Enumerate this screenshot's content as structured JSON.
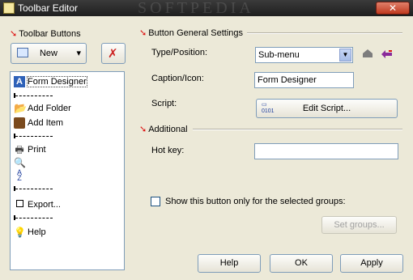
{
  "window": {
    "title": "Toolbar Editor",
    "watermark": "SOFTPEDIA",
    "close_glyph": "✕"
  },
  "left": {
    "section_title": "Toolbar Buttons",
    "new_button": "New",
    "new_dropdown_glyph": "▾",
    "items": [
      {
        "label": "Form Designer",
        "icon": "form-designer-icon",
        "selected": true
      },
      {
        "label": "",
        "divider": true
      },
      {
        "label": "Add Folder",
        "icon": "add-folder-icon"
      },
      {
        "label": "Add Item",
        "icon": "add-item-icon"
      },
      {
        "label": "",
        "divider": true
      },
      {
        "label": "Print",
        "icon": "printer-icon"
      },
      {
        "label": "",
        "icon": "magnifier-icon"
      },
      {
        "label": "",
        "icon": "sort-az-icon"
      },
      {
        "label": "",
        "divider": true
      },
      {
        "label": "Export...",
        "icon": "checkbox-icon"
      },
      {
        "label": "",
        "divider": true
      },
      {
        "label": "Help",
        "icon": "lightbulb-icon"
      }
    ]
  },
  "general": {
    "section_title": "Button General Settings",
    "type_label": "Type/Position:",
    "type_value": "Sub-menu",
    "caption_label": "Caption/Icon:",
    "caption_value": "Form Designer",
    "script_label": "Script:",
    "edit_script_button": "Edit Script..."
  },
  "additional": {
    "section_title": "Additional",
    "hotkey_label": "Hot key:",
    "hotkey_value": ""
  },
  "groups": {
    "checkbox_label": "Show this button only for the selected groups:",
    "set_groups_button": "Set groups..."
  },
  "footer": {
    "help": "Help",
    "ok": "OK",
    "apply": "Apply"
  },
  "colors": {
    "accent_arrow": "#dd1111",
    "titlebar": "#2a2a2a",
    "border": "#7f9db9"
  }
}
